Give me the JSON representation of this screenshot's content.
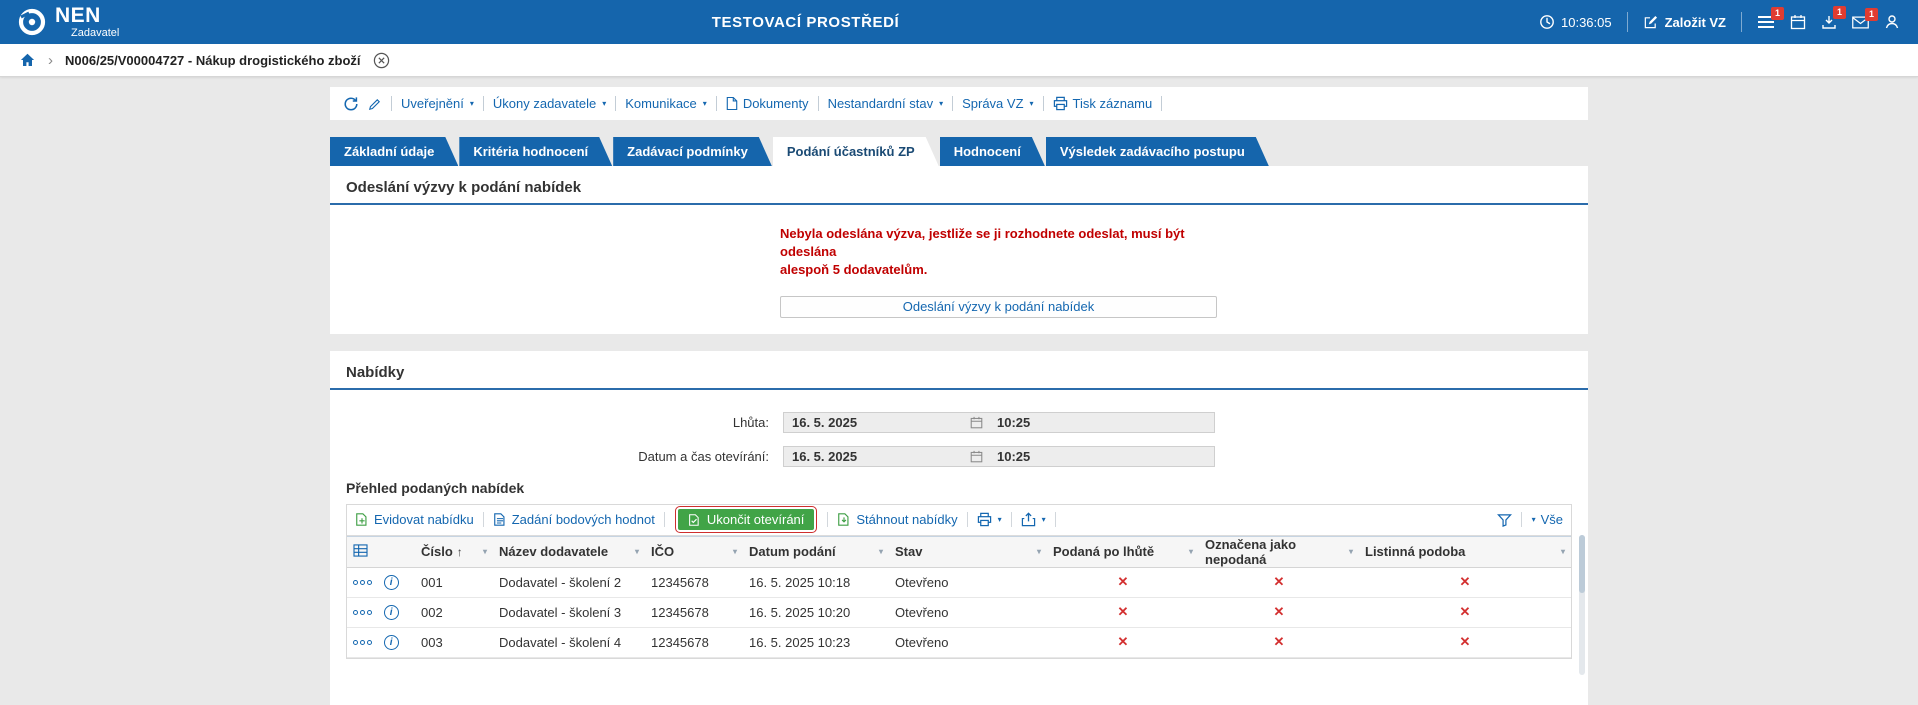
{
  "colors": {
    "header_bg": "#1565ac",
    "accent_blue": "#2b6cab",
    "link_blue": "#1467b0",
    "alert_red": "#c00000",
    "action_green": "#41a447",
    "badge_red": "#e03c31",
    "page_bg": "#e9e9e9"
  },
  "header": {
    "app_name": "NEN",
    "app_role": "Zadavatel",
    "environment": "TESTOVACÍ PROSTŘEDÍ",
    "time": "10:36:05",
    "create_vz_label": "Založit VZ",
    "menu_badge": "1",
    "download_badge": "1",
    "mail_badge": "1"
  },
  "breadcrumb": {
    "record": "N006/25/V00004727 - Nákup drogistického zboží"
  },
  "record_toolbar": {
    "uverejneni": "Uveřejnění",
    "ukony": "Úkony zadavatele",
    "komunikace": "Komunikace",
    "dokumenty": "Dokumenty",
    "nestandardni": "Nestandardní stav",
    "sprava": "Správa VZ",
    "tisk": "Tisk záznamu"
  },
  "tabs": {
    "t0": "Základní údaje",
    "t1": "Kritéria hodnocení",
    "t2": "Zadávací podmínky",
    "t3": "Podání účastníků ZP",
    "t4": "Hodnocení",
    "t5": "Výsledek zadávacího postupu"
  },
  "offer_section": {
    "title": "Odeslání výzvy k podání nabídek",
    "warning_line1": "Nebyla odeslána výzva, jestliže se ji rozhodnete odeslat, musí být odeslána",
    "warning_line2": "alespoň 5 dodavatelům.",
    "send_button": "Odeslání výzvy k podání nabídek"
  },
  "bids_section": {
    "title": "Nabídky",
    "deadline_label": "Lhůta:",
    "deadline_date": "16. 5. 2025",
    "deadline_time": "10:25",
    "opening_label": "Datum a čas otevírání:",
    "opening_date": "16. 5. 2025",
    "opening_time": "10:25",
    "grid_title": "Přehled podaných nabídek"
  },
  "grid_toolbar": {
    "evidovat": "Evidovat nabídku",
    "zadani_bodu": "Zadání bodových hodnot",
    "ukoncit": "Ukončit otevírání",
    "stahnout": "Stáhnout nabídky",
    "vse": "Vše"
  },
  "table": {
    "col_cislo": "Číslo",
    "col_nazev": "Název dodavatele",
    "col_ico": "IČO",
    "col_datum": "Datum podání",
    "col_stav": "Stav",
    "col_po_lhute": "Podaná po lhůtě",
    "col_nepodana": "Označena jako nepodaná",
    "col_listinna": "Listinná podoba",
    "rows": [
      {
        "cislo": "001",
        "nazev": "Dodavatel - školení 2",
        "ico": "12345678",
        "datum": "16. 5. 2025 10:18",
        "stav": "Otevřeno",
        "po_lhute": "✕",
        "nepodana": "✕",
        "listinna": "✕"
      },
      {
        "cislo": "002",
        "nazev": "Dodavatel - školení 3",
        "ico": "12345678",
        "datum": "16. 5. 2025 10:20",
        "stav": "Otevřeno",
        "po_lhute": "✕",
        "nepodana": "✕",
        "listinna": "✕"
      },
      {
        "cislo": "003",
        "nazev": "Dodavatel - školení 4",
        "ico": "12345678",
        "datum": "16. 5. 2025 10:23",
        "stav": "Otevřeno",
        "po_lhute": "✕",
        "nepodana": "✕",
        "listinna": "✕"
      }
    ]
  },
  "icons": {
    "caret_down": "▾",
    "sort_asc": "↑",
    "chevron_right": "›",
    "info": "i"
  }
}
